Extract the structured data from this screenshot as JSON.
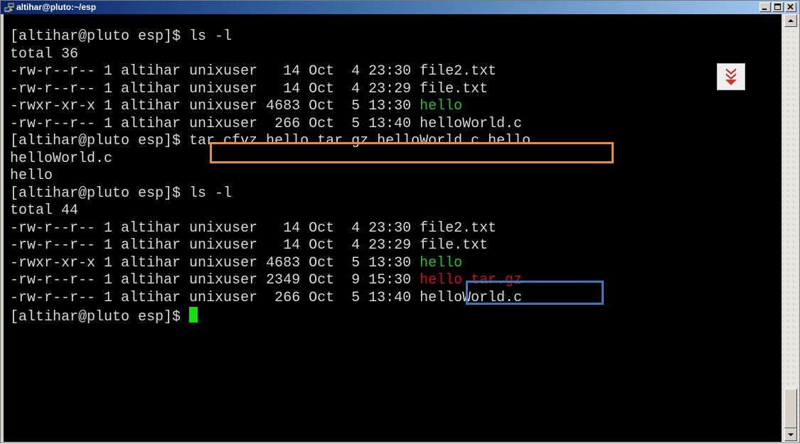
{
  "window": {
    "title": "altihar@pluto:~/esp",
    "minimize_label": "_",
    "maximize_label": "□",
    "close_label": "x"
  },
  "terminal": {
    "lines": [
      [
        {
          "t": "[altihar@pluto esp]$ ls -l"
        }
      ],
      [
        {
          "t": "total 36"
        }
      ],
      [
        {
          "t": "-rw-r--r-- 1 altihar unixuser   14 Oct  4 23:30 file2.txt"
        }
      ],
      [
        {
          "t": "-rw-r--r-- 1 altihar unixuser   14 Oct  4 23:29 file.txt"
        }
      ],
      [
        {
          "t": "-rwxr-xr-x 1 altihar unixuser 4683 Oct  5 13:30 "
        },
        {
          "t": "hello",
          "c": "green"
        }
      ],
      [
        {
          "t": "-rw-r--r-- 1 altihar unixuser  266 Oct  5 13:40 helloWorld.c"
        }
      ],
      [
        {
          "t": "[altihar@pluto esp]$ tar cfvz hello.tar.gz helloWorld.c hello"
        }
      ],
      [
        {
          "t": "helloWorld.c"
        }
      ],
      [
        {
          "t": "hello"
        }
      ],
      [
        {
          "t": "[altihar@pluto esp]$ ls -l"
        }
      ],
      [
        {
          "t": "total 44"
        }
      ],
      [
        {
          "t": "-rw-r--r-- 1 altihar unixuser   14 Oct  4 23:30 file2.txt"
        }
      ],
      [
        {
          "t": "-rw-r--r-- 1 altihar unixuser   14 Oct  4 23:29 file.txt"
        }
      ],
      [
        {
          "t": "-rwxr-xr-x 1 altihar unixuser 4683 Oct  5 13:30 "
        },
        {
          "t": "hello",
          "c": "green"
        }
      ],
      [
        {
          "t": "-rw-r--r-- 1 altihar unixuser 2349 Oct  9 15:30 "
        },
        {
          "t": "hello.tar.gz",
          "c": "red"
        }
      ],
      [
        {
          "t": "-rw-r--r-- 1 altihar unixuser  266 Oct  5 13:40 helloWorld.c"
        }
      ],
      [
        {
          "t": "[altihar@pluto esp]$ "
        },
        {
          "cursor": true
        }
      ]
    ]
  },
  "colors": {
    "executable": "#2ac02a",
    "archive": "#d01010",
    "cursor": "#10e010",
    "highlight_command": "#f08a3c",
    "highlight_archive": "#3a78c2"
  },
  "icons": {
    "scroll_to_bottom": "double-chevron-down-icon"
  }
}
